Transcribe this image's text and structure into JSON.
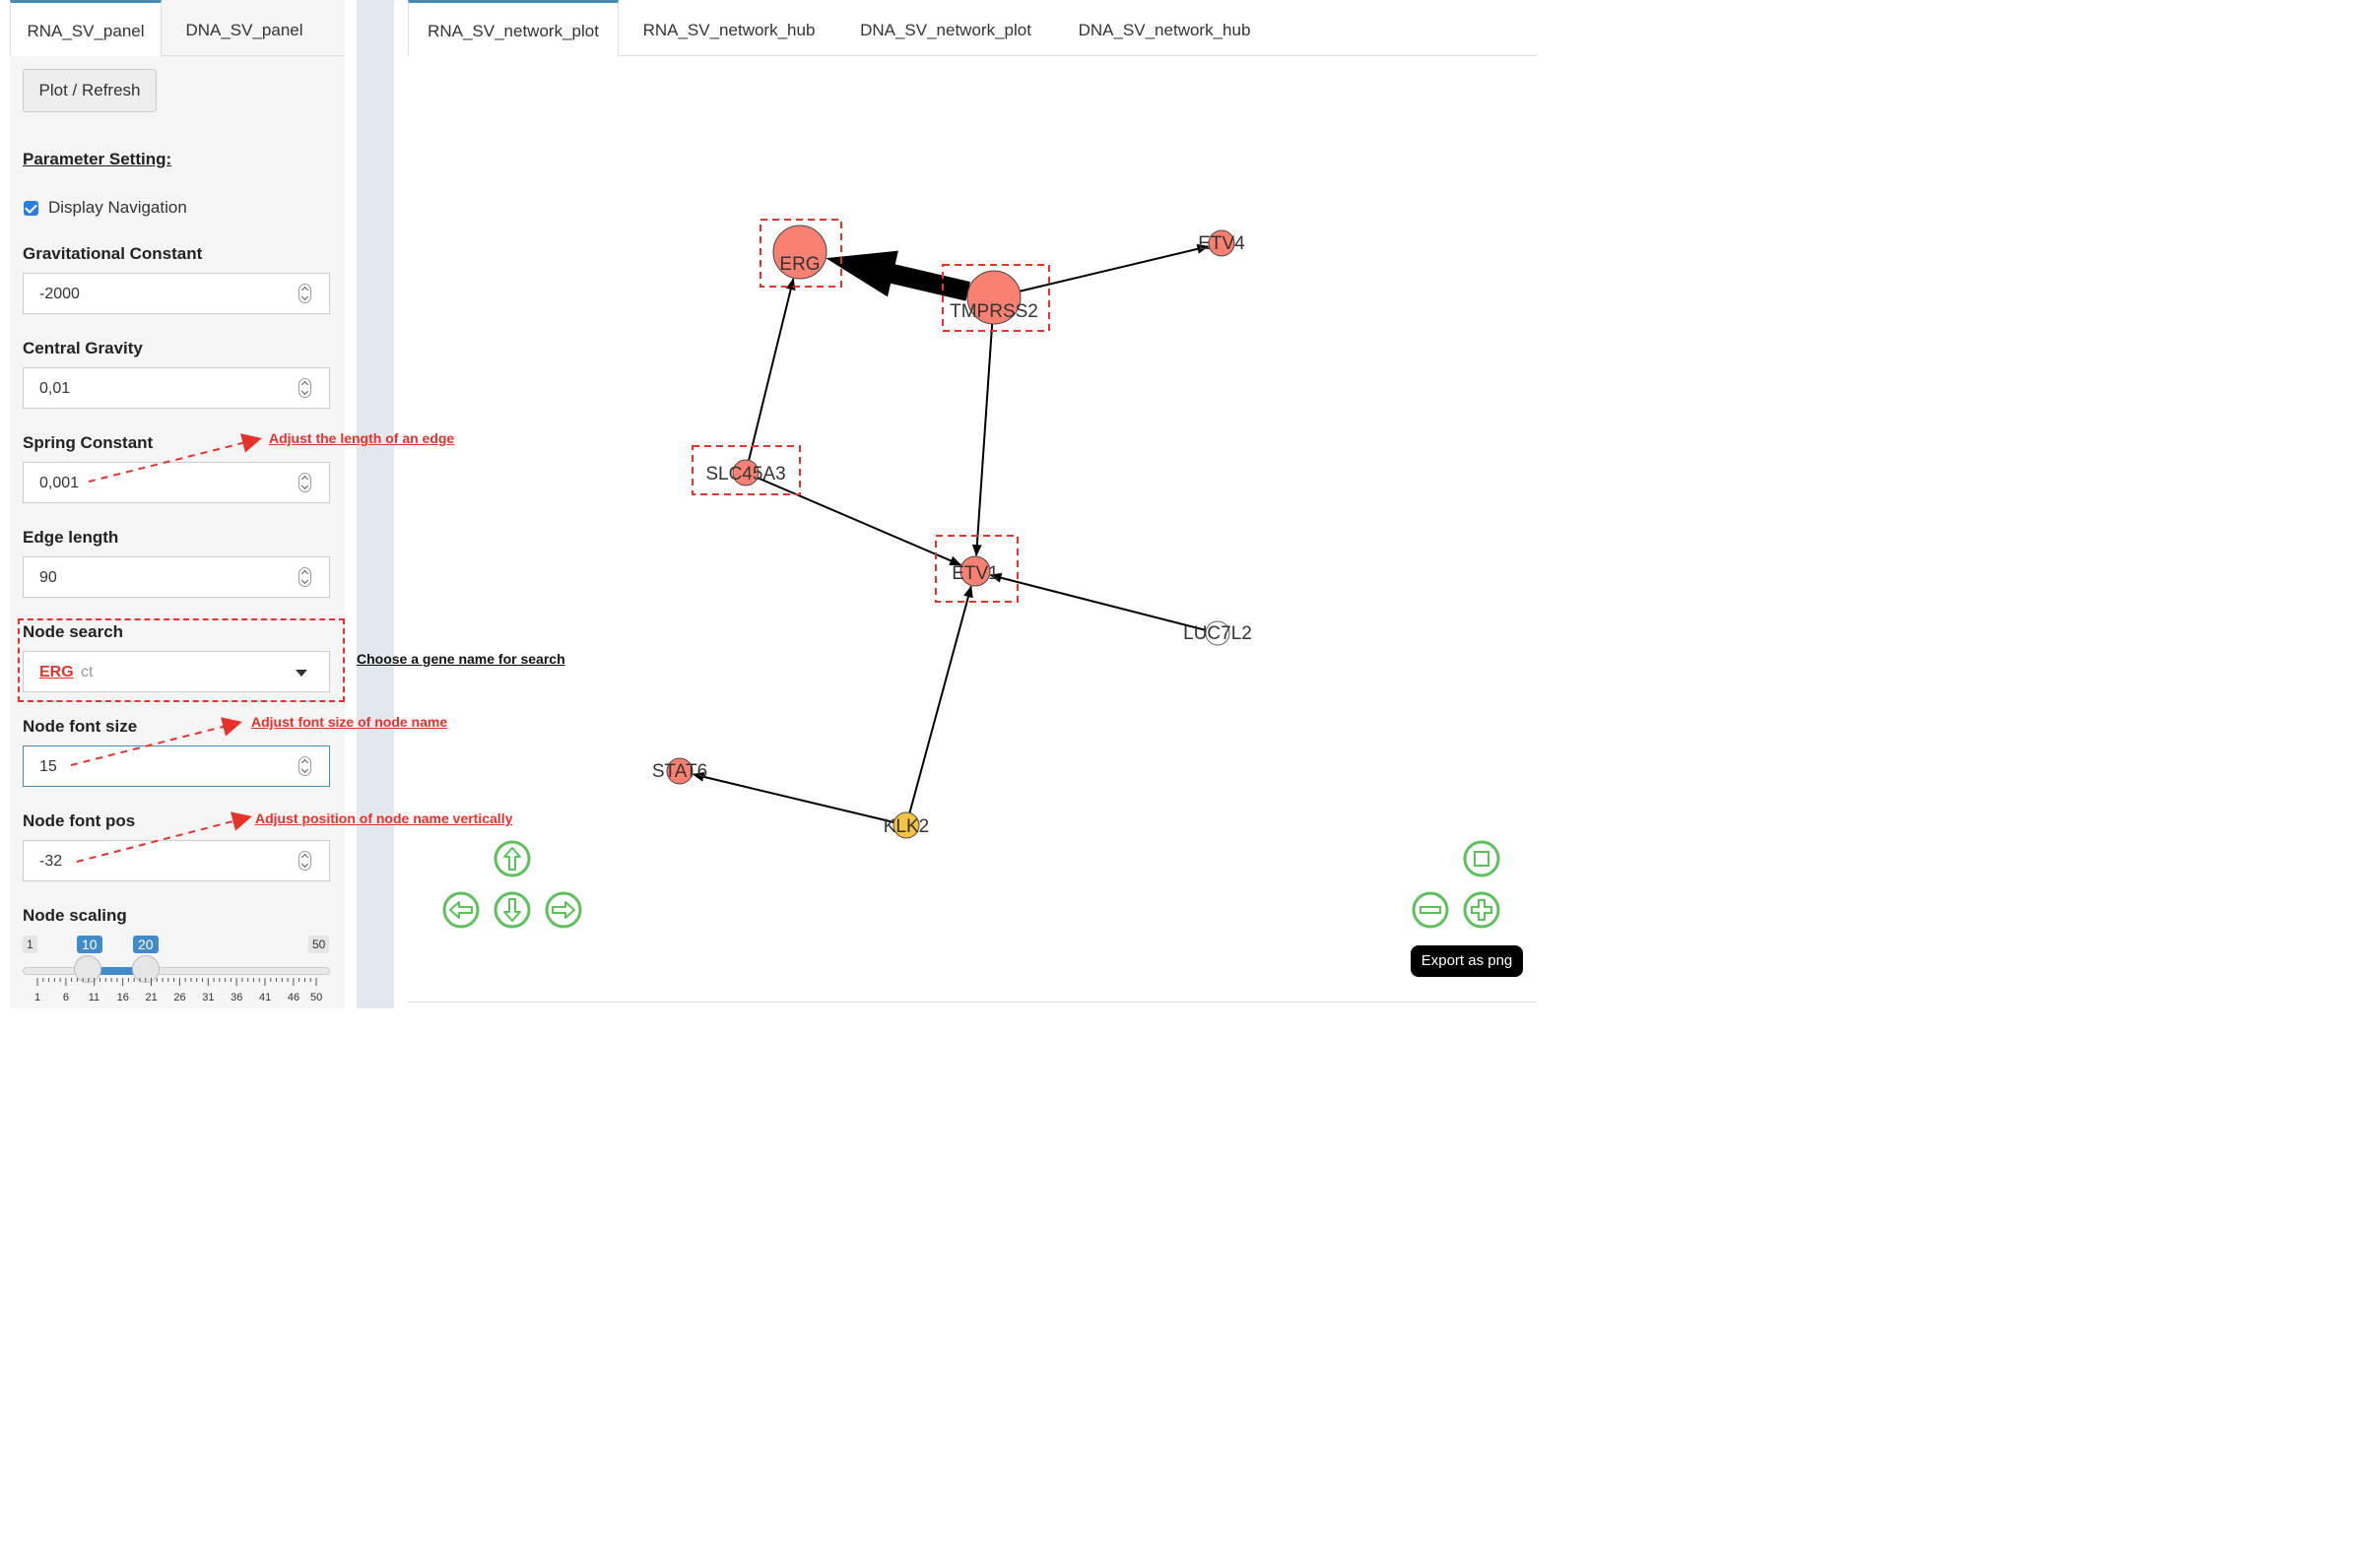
{
  "left_tabs": [
    {
      "label": "RNA_SV_panel",
      "active": true
    },
    {
      "label": "DNA_SV_panel",
      "active": false
    }
  ],
  "right_tabs": [
    {
      "label": "RNA_SV_network_plot",
      "active": true
    },
    {
      "label": "RNA_SV_network_hub",
      "active": false
    },
    {
      "label": "DNA_SV_network_plot",
      "active": false
    },
    {
      "label": "DNA_SV_network_hub",
      "active": false
    }
  ],
  "sidebar": {
    "refresh_button": "Plot / Refresh",
    "param_heading": "Parameter Setting:",
    "display_nav_label": "Display Navigation",
    "display_nav_checked": true,
    "fields": {
      "grav_label": "Gravitational Constant",
      "grav_value": "-2000",
      "central_label": "Central Gravity",
      "central_value": "0,01",
      "spring_label": "Spring Constant",
      "spring_value": "0,001",
      "edge_label": "Edge length",
      "edge_value": "90",
      "node_search_label": "Node search",
      "node_search_placeholder": "Select",
      "node_search_value": "ERG",
      "font_size_label": "Node font size",
      "font_size_value": "15",
      "font_pos_label": "Node font pos",
      "font_pos_value": "-32",
      "scaling_label": "Node scaling"
    },
    "slider": {
      "min": "1",
      "max": "50",
      "low": "10",
      "high": "20",
      "ticks": [
        "1",
        "6",
        "11",
        "16",
        "21",
        "26",
        "31",
        "36",
        "41",
        "46",
        "50"
      ]
    }
  },
  "annotations": {
    "spring": "Adjust the length of an edge",
    "search": "Choose a gene name for search",
    "font_size": "Adjust font size of node name",
    "font_pos": "Adjust position of node name vertically"
  },
  "network": {
    "nodes": [
      {
        "id": "ERG",
        "label": "ERG",
        "color": "#fa8072",
        "size": "large",
        "highlighted": true
      },
      {
        "id": "TMPRSS2",
        "label": "TMPRSS2",
        "color": "#fa8072",
        "size": "large",
        "highlighted": true
      },
      {
        "id": "ETV4",
        "label": "ETV4",
        "color": "#fa8072",
        "size": "small",
        "highlighted": false
      },
      {
        "id": "SLC45A3",
        "label": "SLC45A3",
        "color": "#fa8072",
        "size": "small",
        "highlighted": true
      },
      {
        "id": "ETV1",
        "label": "ETV1",
        "color": "#fa8072",
        "size": "small",
        "highlighted": true
      },
      {
        "id": "LUC7L2",
        "label": "LUC7L2",
        "color": "#ffffff",
        "size": "small",
        "highlighted": false
      },
      {
        "id": "STAT6",
        "label": "STAT6",
        "color": "#fa8072",
        "size": "small",
        "highlighted": false
      },
      {
        "id": "KLK2",
        "label": "KLK2",
        "color": "#f5c242",
        "size": "small",
        "highlighted": false
      }
    ],
    "edges": [
      {
        "from": "TMPRSS2",
        "to": "ERG",
        "weight": "heavy"
      },
      {
        "from": "TMPRSS2",
        "to": "ETV4",
        "weight": "normal"
      },
      {
        "from": "TMPRSS2",
        "to": "ETV1",
        "weight": "normal"
      },
      {
        "from": "SLC45A3",
        "to": "ERG",
        "weight": "normal"
      },
      {
        "from": "SLC45A3",
        "to": "ETV1",
        "weight": "normal"
      },
      {
        "from": "LUC7L2",
        "to": "ETV1",
        "weight": "normal"
      },
      {
        "from": "KLK2",
        "to": "ETV1",
        "weight": "normal"
      },
      {
        "from": "KLK2",
        "to": "STAT6",
        "weight": "normal"
      }
    ]
  },
  "nav_buttons": {
    "up": "arrow-up-icon",
    "down": "arrow-down-icon",
    "left": "arrow-left-icon",
    "right": "arrow-right-icon",
    "fit": "fit-icon",
    "zoom_out": "zoom-out-icon",
    "zoom_in": "zoom-in-icon"
  },
  "export_label": "Export as png",
  "colors": {
    "nav_green": "#5cc15c",
    "highlight_red": "#e8312a",
    "accent_blue": "#428bca"
  }
}
